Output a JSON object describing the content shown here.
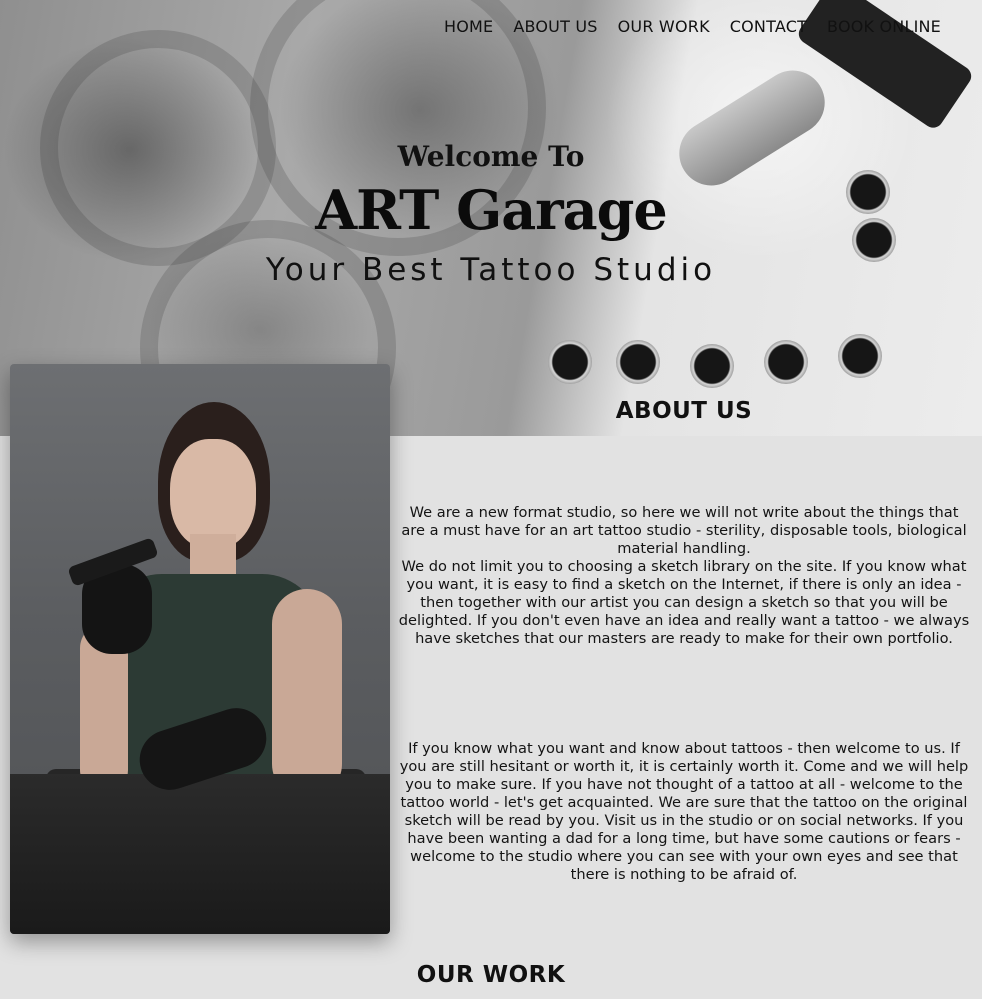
{
  "nav": {
    "items": [
      "HOME",
      "ABOUT US",
      "OUR WORK",
      "CONTACT",
      "BOOK ONLINE"
    ]
  },
  "hero": {
    "welcome": "Welcome To",
    "brand": "ART Garage",
    "tagline": "Your Best Tattoo Studio",
    "background_icon": "tattoo-machine-and-ink-caps-image"
  },
  "about": {
    "title": "ABOUT US",
    "photo_icon": "tattoo-artist-portrait-image",
    "paragraph_1": "We are a new format studio, so here we will not write about the things that are a must have for an art tattoo studio - sterility, disposable tools, biological material handling.",
    "paragraph_2": "We do not limit you to choosing a sketch library on the site. If you know what you want, it is easy to find a sketch on the Internet, if there is only an idea - then together with our artist you can design a sketch so that you will be delighted. If you don't even have an idea and really want a tattoo - we always have sketches that our masters are ready to make for their own portfolio.",
    "paragraph_3": "If you know what you want and know about tattoos - then welcome to us. If you are still hesitant or worth it, it is certainly worth it. Come and we will help you to make sure. If you have not thought of a tattoo at all - welcome to the tattoo world - let's get acquainted. We are sure that the tattoo on the original sketch will be read by you. Visit us in the studio or on social networks. If you have been wanting a dad for a long time, but have some cautions or fears - welcome to the studio where you can see with your own eyes and see that there is nothing to be afraid of."
  },
  "work": {
    "title": "OUR WORK"
  },
  "colors": {
    "page_background": "#e2e2e2",
    "text": "#111111"
  }
}
